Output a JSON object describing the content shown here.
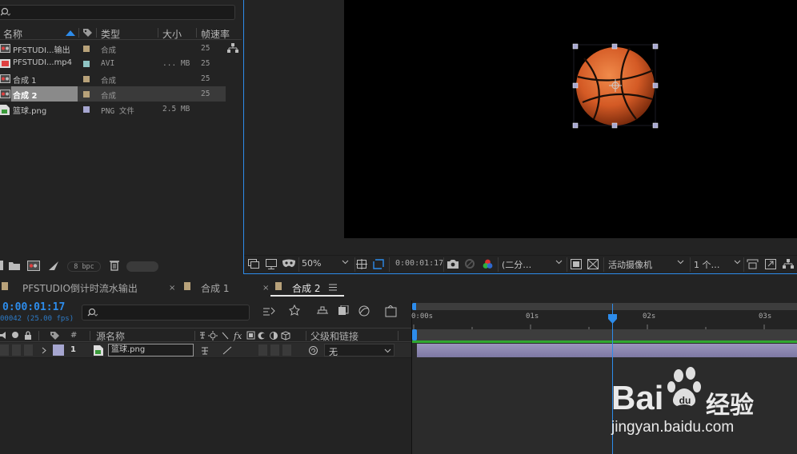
{
  "project": {
    "search_placeholder": "",
    "columns": {
      "name": "名称",
      "type": "类型",
      "size": "大小",
      "fps": "帧速率"
    },
    "items": [
      {
        "name": "PFSTUDI...输出",
        "type": "合成",
        "size": "",
        "fps": "25",
        "label_color": "#b8a27a",
        "icon": "composition-icon",
        "selected": false
      },
      {
        "name": "PFSTUDI...mp4",
        "type": "AVI",
        "size": "... MB",
        "fps": "25",
        "label_color": "#8fc4c4",
        "icon": "video-file-icon",
        "selected": false
      },
      {
        "name": "合成 1",
        "type": "合成",
        "size": "",
        "fps": "25",
        "label_color": "#b8a27a",
        "icon": "composition-icon",
        "selected": false
      },
      {
        "name": "合成 2",
        "type": "合成",
        "size": "",
        "fps": "25",
        "label_color": "#b8a27a",
        "icon": "composition-icon",
        "selected": true
      },
      {
        "name": "篮球.png",
        "type": "PNG 文件",
        "size": "2.5 MB",
        "fps": "",
        "label_color": "#a6a6d0",
        "icon": "image-file-icon",
        "selected": false
      }
    ],
    "footer_bpc": "8 bpc"
  },
  "viewer": {
    "zoom": "50%",
    "timecode": "0:00:01:17",
    "resolution": "(二分…",
    "camera": "活动摄像机",
    "views": "1 个…"
  },
  "tabs": [
    {
      "label": "PFSTUDIO倒计时流水输出",
      "color": "#b8a27a",
      "active": false
    },
    {
      "label": "合成 1",
      "color": "#b8a27a",
      "active": false
    },
    {
      "label": "合成 2",
      "color": "#b8a27a",
      "active": true
    }
  ],
  "timeline": {
    "timecode": "0:00:01:17",
    "frame_info": "00042 (25.00 fps)",
    "columns": {
      "hash": "#",
      "source": "源名称",
      "parent": "父级和链接"
    },
    "layer": {
      "index": "1",
      "name": "篮球.png",
      "parent": "无",
      "label_color": "#a6a6d0"
    },
    "ruler": [
      "0:00s",
      "01s",
      "02s",
      "03s"
    ]
  },
  "watermark": {
    "brand": "Bai",
    "brand2": "经验",
    "url": "jingyan.baidu.com"
  },
  "colors": {
    "accent": "#2d8ceb",
    "layer_bar": "#8a86b0",
    "work_area": "#31a831"
  }
}
